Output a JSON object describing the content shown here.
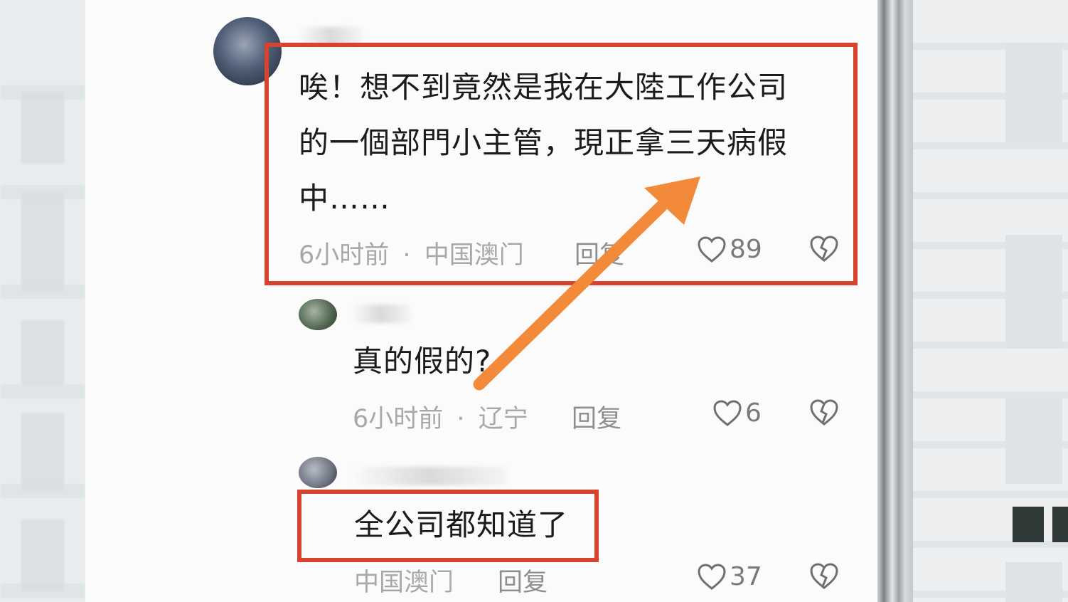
{
  "comments": [
    {
      "text_lines": [
        "唉！想不到竟然是我在大陸工作公司",
        "的一個部門小主管，現正拿三天病假",
        "中……"
      ],
      "time": "6小时前",
      "location": "中国澳门",
      "reply_label": "回复",
      "likes": "89"
    },
    {
      "text": "真的假的?",
      "time": "6小时前",
      "location": "辽宁",
      "reply_label": "回复",
      "likes": "6"
    },
    {
      "text": "全公司都知道了",
      "location": "中国澳门",
      "reply_label": "回复",
      "likes": "37"
    }
  ],
  "separator": "·",
  "colors": {
    "highlight_box": "#d6432f",
    "arrow": "#f28a3a"
  },
  "icons": [
    "heart-like-icon",
    "broken-heart-dislike-icon"
  ]
}
